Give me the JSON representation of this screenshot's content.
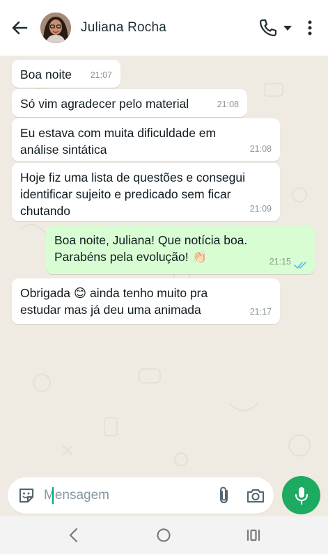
{
  "header": {
    "contact_name": "Juliana Rocha"
  },
  "messages": [
    {
      "direction": "in",
      "text": "Boa noite",
      "time": "21:07"
    },
    {
      "direction": "in",
      "text": "Só vim agradecer pelo material",
      "time": "21:08"
    },
    {
      "direction": "in",
      "text": "Eu estava com muita dificuldade em análise sintática",
      "time": "21:08"
    },
    {
      "direction": "in",
      "text": "Hoje fiz uma lista de questões e consegui identificar sujeito e predicado sem ficar chutando",
      "time": "21:09"
    },
    {
      "direction": "out",
      "text": "Boa noite, Juliana! Que notícia boa. Parabéns pela evolução! 👏🏻",
      "time": "21:15",
      "status": "read"
    },
    {
      "direction": "in",
      "text": "Obrigada 😊 ainda tenho muito pra estudar mas já deu uma animada",
      "time": "21:17"
    }
  ],
  "composer": {
    "placeholder": "Mensagem"
  },
  "icons": {
    "back": "arrow-left-icon",
    "call": "phone-icon",
    "dropdown": "caret-down-icon",
    "more": "more-vertical-icon",
    "sticker": "sticker-icon",
    "attach": "paperclip-icon",
    "camera": "camera-icon",
    "mic": "microphone-icon"
  },
  "colors": {
    "chat_background": "#efeae2",
    "incoming_bubble": "#ffffff",
    "outgoing_bubble": "#d9fdd3",
    "accent_green": "#1daa61",
    "read_ticks": "#53bdeb"
  }
}
